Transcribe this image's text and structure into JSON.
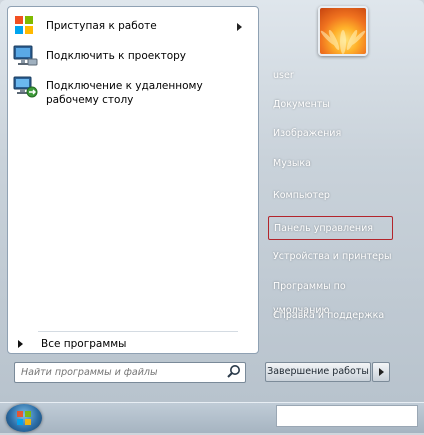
{
  "programs": [
    {
      "label": "Приступая к работе",
      "icon": "getting-started-icon",
      "has_submenu": true
    },
    {
      "label": "Подключить к проектору",
      "icon": "projector-icon",
      "has_submenu": false
    },
    {
      "label": "Подключение к удаленному рабочему столу",
      "icon": "remote-desktop-icon",
      "has_submenu": false
    }
  ],
  "all_programs_label": "Все программы",
  "search": {
    "placeholder": "Найти программы и файлы",
    "icon": "search-icon"
  },
  "right_links": [
    {
      "label": "user"
    },
    {
      "label": "Документы"
    },
    {
      "label": "Изображения"
    },
    {
      "label": "Музыка"
    },
    {
      "label": "Компьютер"
    },
    {
      "label": "Панель управления",
      "highlighted": true
    },
    {
      "label": "Устройства и принтеры"
    },
    {
      "label": "Программы по умолчанию"
    },
    {
      "label": "Справка и поддержка"
    }
  ],
  "shutdown_label": "Завершение работы",
  "colors": {
    "highlight_border": "#b3252b",
    "panel_bg": "#ffffff"
  }
}
